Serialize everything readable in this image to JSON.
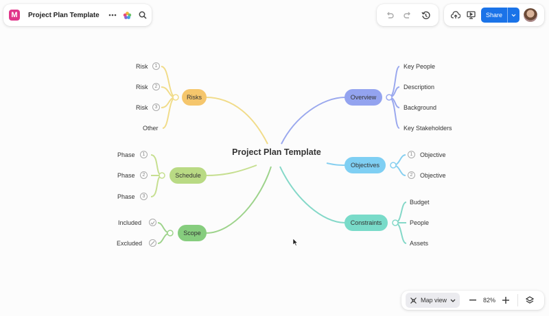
{
  "toolbar": {
    "logo_letter": "M",
    "doc_title": "Project Plan Template",
    "share_label": "Share",
    "icons": [
      "more-dots",
      "palette",
      "search",
      "undo",
      "redo",
      "history",
      "cloud-upload",
      "present",
      "chevron-down",
      "avatar"
    ]
  },
  "bottom_bar": {
    "view_label": "Map view",
    "zoom": "82%"
  },
  "map": {
    "central": "Project Plan Template",
    "risks": {
      "label": "Risks",
      "color": "#f5c66c",
      "line": "#f1dc8a",
      "leaves": [
        {
          "t": "Risk",
          "n": "1"
        },
        {
          "t": "Risk",
          "n": "2"
        },
        {
          "t": "Risk",
          "n": "3"
        },
        {
          "t": "Other",
          "n": ""
        }
      ]
    },
    "schedule": {
      "label": "Schedule",
      "color": "#b9da84",
      "line": "#c6df90",
      "leaves": [
        {
          "t": "Phase",
          "n": "1"
        },
        {
          "t": "Phase",
          "n": "2"
        },
        {
          "t": "Phase",
          "n": "3"
        }
      ]
    },
    "scope": {
      "label": "Scope",
      "color": "#86cd7e",
      "line": "#9dd38b",
      "leaves": [
        "Included",
        "Excluded"
      ]
    },
    "overview": {
      "label": "Overview",
      "color": "#93a3ef",
      "line": "#9aa8ee",
      "leaves": [
        "Key People",
        "Description",
        "Background",
        "Key Stakeholders"
      ]
    },
    "objectives": {
      "label": "Objectives",
      "color": "#7fcff3",
      "line": "#86cff0",
      "leaves": [
        {
          "t": "Objective",
          "n": "1"
        },
        {
          "t": "Objective",
          "n": "2"
        }
      ]
    },
    "constraints": {
      "label": "Constraints",
      "color": "#79dbc9",
      "line": "#84d8c8",
      "leaves": [
        "Budget",
        "People",
        "Assets"
      ]
    }
  }
}
